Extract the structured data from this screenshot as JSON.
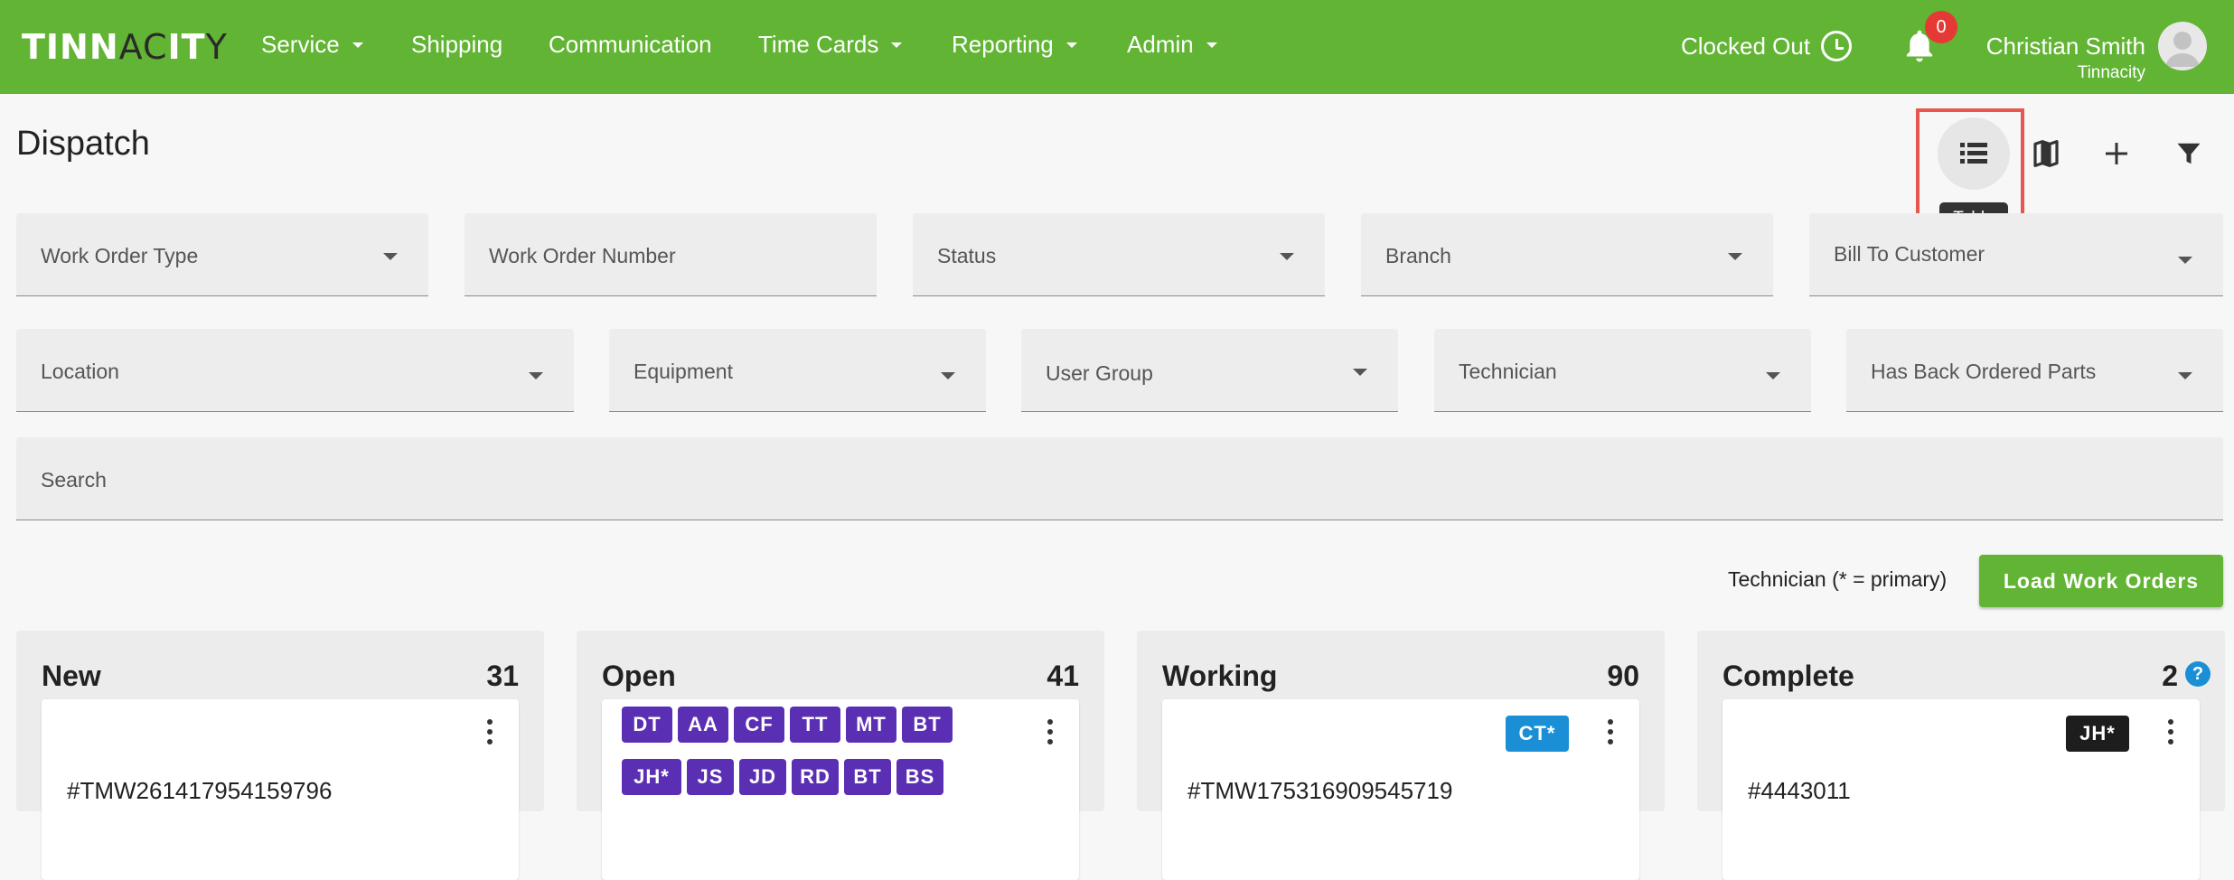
{
  "brand": {
    "logo_text_a": "TINN",
    "logo_text_b": "AC",
    "logo_text_c": "IT",
    "logo_text_d": "Y"
  },
  "nav": [
    {
      "label": "Service",
      "dropdown": true
    },
    {
      "label": "Shipping",
      "dropdown": false
    },
    {
      "label": "Communication",
      "dropdown": false
    },
    {
      "label": "Time Cards",
      "dropdown": true
    },
    {
      "label": "Reporting",
      "dropdown": true
    },
    {
      "label": "Admin",
      "dropdown": true
    }
  ],
  "header": {
    "clock_status": "Clocked Out",
    "notification_count": "0",
    "user_name": "Christian Smith",
    "user_org": "Tinnacity"
  },
  "page": {
    "title": "Dispatch"
  },
  "toolbar": {
    "table_icon": "list-icon",
    "map_icon": "map-icon",
    "add_icon": "plus-icon",
    "filter_icon": "filter-icon",
    "tooltip": "Table"
  },
  "filters": {
    "row1": [
      "Work Order Type",
      "Work Order Number",
      "Status",
      "Branch",
      "Bill To Customer"
    ],
    "row2": [
      "Location",
      "Equipment",
      "User Group",
      "Technician",
      "Has Back Ordered Parts"
    ],
    "search_label": "Search"
  },
  "actions": {
    "tech_legend": "Technician (* = primary)",
    "load_button": "Load Work Orders"
  },
  "columns": [
    {
      "title": "New",
      "count": "31",
      "card_number": "#TMW261417954159796",
      "tags": []
    },
    {
      "title": "Open",
      "count": "41",
      "card_number": "",
      "tags": [
        "DT",
        "AA",
        "CF",
        "TT",
        "MT",
        "BT",
        "JH*",
        "JS",
        "JD",
        "RD",
        "BT",
        "BS"
      ]
    },
    {
      "title": "Working",
      "count": "90",
      "card_number": "#TMW175316909545719",
      "tags": [
        "CT*"
      ]
    },
    {
      "title": "Complete",
      "count": "2",
      "card_number": "#4443011",
      "tags": [
        "JH*"
      ]
    }
  ],
  "colors": {
    "brand_green": "#62b434",
    "tag_purple": "#5b2fb3",
    "tag_blue": "#1a8fd6",
    "tag_black": "#1d1d1d",
    "badge_red": "#e53935",
    "highlight_red": "#e8564f"
  }
}
